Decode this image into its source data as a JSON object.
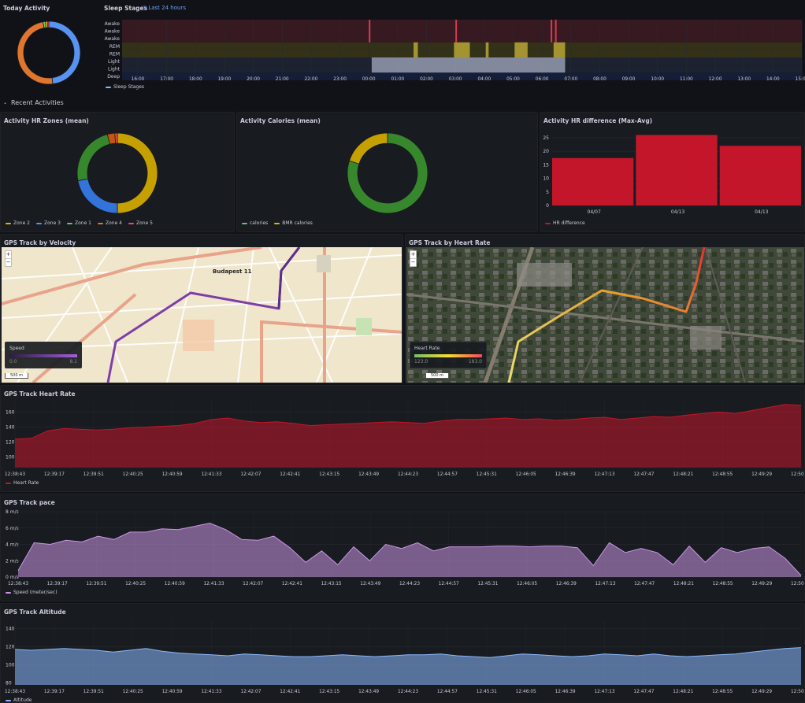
{
  "today_activity": {
    "title": "Today Activity",
    "segments": [
      {
        "color": "#5794f2",
        "value": 0.48
      },
      {
        "color": "#e0752d",
        "value": 0.49
      },
      {
        "color": "#73bf69",
        "value": 0.012
      },
      {
        "color": "#fade2a",
        "value": 0.01
      },
      {
        "color": "#f2495c",
        "value": 0.008
      }
    ]
  },
  "sleep_stages": {
    "title": "Sleep Stages",
    "range_label": "Last 24 hours",
    "rows": [
      "Awake",
      "Awake",
      "Awake",
      "REM",
      "REM",
      "Light",
      "Light",
      "Deep"
    ],
    "time_ticks": [
      "16:00",
      "17:00",
      "18:00",
      "19:00",
      "20:00",
      "21:00",
      "22:00",
      "23:00",
      "00:00",
      "01:00",
      "02:00",
      "03:00",
      "04:00",
      "05:00",
      "06:00",
      "07:00",
      "08:00",
      "09:00",
      "10:00",
      "11:00",
      "12:00",
      "13:00",
      "14:00",
      "15:00"
    ],
    "legend": "Sleep Stages"
  },
  "recent_activities": {
    "label": "Recent Activities"
  },
  "hr_zones": {
    "title": "Activity HR Zones (mean)",
    "legend": [
      {
        "label": "Zone 2",
        "color": "#e0b400"
      },
      {
        "label": "Zone 3",
        "color": "#5794f2"
      },
      {
        "label": "Zone 1",
        "color": "#73bf69"
      },
      {
        "label": "Zone 4",
        "color": "#e0752d"
      },
      {
        "label": "Zone 5",
        "color": "#f2495c"
      }
    ],
    "segments": [
      {
        "color": "#c4a000",
        "value": 0.5
      },
      {
        "color": "#3274d9",
        "value": 0.22
      },
      {
        "color": "#37872d",
        "value": 0.24
      },
      {
        "color": "#c4570c",
        "value": 0.03
      },
      {
        "color": "#f2495c",
        "value": 0.01
      }
    ]
  },
  "calories": {
    "title": "Activity Calories (mean)",
    "legend": [
      {
        "label": "calories",
        "color": "#73bf69"
      },
      {
        "label": "BMR calories",
        "color": "#e0b400"
      }
    ],
    "segments": [
      {
        "color": "#37872d",
        "value": 0.8
      },
      {
        "color": "#c4a000",
        "value": 0.2
      }
    ]
  },
  "hr_difference": {
    "title": "Activity HR difference (Max-Avg)",
    "legend": "HR difference",
    "color": "#c4162a"
  },
  "gps_velocity": {
    "title": "GPS Track by Velocity",
    "city_label": "Budapest 11",
    "legend_title": "Speed",
    "legend_min": "0.0",
    "legend_max": "8.1",
    "scale": "500 m"
  },
  "gps_heart": {
    "title": "GPS Track by Heart Rate",
    "legend_title": "Heart Rate",
    "legend_min": "123.0",
    "legend_max": "183.0",
    "scale": "500 m"
  },
  "time_ticks": [
    "12:38:43",
    "12:39:17",
    "12:39:51",
    "12:40:25",
    "12:40:59",
    "12:41:33",
    "12:42:07",
    "12:42:41",
    "12:43:15",
    "12:43:49",
    "12:44:23",
    "12:44:57",
    "12:45:31",
    "12:46:05",
    "12:46:39",
    "12:47:13",
    "12:47:47",
    "12:48:21",
    "12:48:55",
    "12:49:29",
    "12:50:03"
  ],
  "gps_hr": {
    "title": "GPS Track Heart Rate",
    "legend": "Heart Rate",
    "color": "#c4162a"
  },
  "gps_pace": {
    "title": "GPS Track pace",
    "legend": "Speed (meter/sec)",
    "color": "#ca95e5"
  },
  "gps_alt": {
    "title": "GPS Track Altitude",
    "legend": "Altitude",
    "color": "#8ab8ff"
  },
  "chart_data": [
    {
      "type": "bar",
      "title": "Activity HR difference (Max-Avg)",
      "categories": [
        "04/07",
        "04/13",
        "04/13"
      ],
      "series": [
        {
          "name": "HR difference",
          "values": [
            17.5,
            26,
            22
          ]
        }
      ],
      "ylim": [
        0,
        27
      ],
      "yticks": [
        0,
        5,
        10,
        15,
        20,
        25
      ],
      "color": "#c4162a"
    },
    {
      "type": "area",
      "title": "GPS Track Heart Rate",
      "ylim": [
        86,
        174
      ],
      "yticks": [
        100,
        120,
        140,
        160
      ],
      "series": [
        {
          "name": "Heart Rate",
          "values": [
            124,
            125,
            135,
            138,
            137,
            136,
            137,
            139,
            140,
            141,
            142,
            145,
            150,
            152,
            148,
            146,
            147,
            145,
            142,
            143,
            144,
            145,
            146,
            147,
            146,
            145,
            148,
            150,
            150,
            151,
            152,
            150,
            151,
            149,
            150,
            152,
            153,
            150,
            152,
            154,
            153,
            156,
            158,
            160,
            158,
            162,
            166,
            170,
            169
          ]
        }
      ],
      "color": "#c4162a"
    },
    {
      "type": "area",
      "title": "GPS Track pace",
      "ylim": [
        0,
        8
      ],
      "yticks": [
        0,
        2,
        4,
        6,
        8
      ],
      "yunit": "m/s",
      "series": [
        {
          "name": "Speed (meter/sec)",
          "values": [
            0.8,
            4.2,
            4.0,
            4.5,
            4.3,
            5.0,
            4.6,
            5.5,
            5.5,
            5.9,
            5.8,
            6.2,
            6.6,
            5.8,
            4.6,
            4.5,
            5.0,
            3.6,
            1.8,
            3.2,
            1.5,
            3.7,
            2.0,
            4.0,
            3.5,
            4.2,
            3.2,
            3.7,
            3.7,
            3.7,
            3.8,
            3.8,
            3.7,
            3.8,
            3.8,
            3.6,
            1.4,
            4.2,
            3.0,
            3.5,
            3.0,
            1.5,
            3.8,
            1.8,
            3.6,
            3.0,
            3.5,
            3.7,
            2.3,
            0.2
          ]
        }
      ],
      "color": "#ca95e5"
    },
    {
      "type": "area",
      "title": "GPS Track Altitude",
      "ylim": [
        78,
        148
      ],
      "yticks": [
        80,
        100,
        120,
        140
      ],
      "series": [
        {
          "name": "Altitude",
          "values": [
            117,
            116,
            117,
            118,
            117,
            116,
            114,
            116,
            118,
            115,
            113,
            112,
            111,
            110,
            112,
            111,
            110,
            109,
            109,
            110,
            111,
            110,
            109,
            110,
            111,
            111,
            112,
            110,
            109,
            108,
            110,
            112,
            111,
            110,
            109,
            110,
            112,
            111,
            110,
            112,
            110,
            109,
            110,
            111,
            112,
            114,
            116,
            118,
            119
          ]
        }
      ],
      "color": "#8ab8ff"
    }
  ]
}
